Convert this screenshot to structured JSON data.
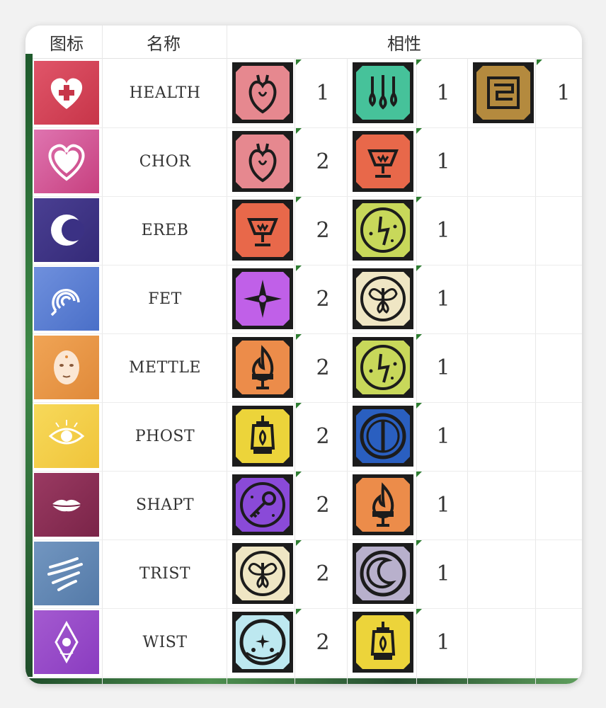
{
  "headers": {
    "icon": "图标",
    "name": "名称",
    "affinity": "相性"
  },
  "rows": [
    {
      "name": "HEALTH",
      "icon": "heart-plus-icon",
      "color_top": "#e05569",
      "color_bottom": "#c73549",
      "affinities": [
        {
          "icon": "anatomical-heart-icon",
          "bg": "#e6888f",
          "value": "1"
        },
        {
          "icon": "drops-icon",
          "bg": "#46c29a",
          "value": "1"
        },
        {
          "icon": "rune-tablet-icon",
          "bg": "#b48a3e",
          "value": "1"
        }
      ]
    },
    {
      "name": "CHOR",
      "icon": "heart-icon",
      "color_top": "#df74b0",
      "color_bottom": "#c7407f",
      "affinities": [
        {
          "icon": "anatomical-heart-icon",
          "bg": "#e6888f",
          "value": "2"
        },
        {
          "icon": "chalice-icon",
          "bg": "#e8684a",
          "value": "1"
        }
      ]
    },
    {
      "name": "EREB",
      "icon": "crescent-moon-icon",
      "color_top": "#4a3f92",
      "color_bottom": "#342a78",
      "affinities": [
        {
          "icon": "chalice-icon",
          "bg": "#e8684a",
          "value": "2"
        },
        {
          "icon": "lightning-icon",
          "bg": "#c8d85a",
          "value": "1"
        }
      ]
    },
    {
      "name": "FET",
      "icon": "spiral-icon",
      "color_top": "#6f90dd",
      "color_bottom": "#4a6fc8",
      "affinities": [
        {
          "icon": "star-compass-icon",
          "bg": "#c060e8",
          "value": "2"
        },
        {
          "icon": "moth-icon",
          "bg": "#efe6c4",
          "value": "1"
        }
      ]
    },
    {
      "name": "METTLE",
      "icon": "mask-icon",
      "color_top": "#f0a455",
      "color_bottom": "#e08a3a",
      "affinities": [
        {
          "icon": "flame-anvil-icon",
          "bg": "#ec8c4a",
          "value": "2"
        },
        {
          "icon": "lightning-icon",
          "bg": "#c8d85a",
          "value": "1"
        }
      ]
    },
    {
      "name": "PHOST",
      "icon": "eye-icon",
      "color_top": "#f7d95a",
      "color_bottom": "#f0c43a",
      "affinities": [
        {
          "icon": "lantern-icon",
          "bg": "#ecd43a",
          "value": "2"
        },
        {
          "icon": "shield-orb-icon",
          "bg": "#2a5fc0",
          "value": "1"
        }
      ]
    },
    {
      "name": "SHAPT",
      "icon": "lips-icon",
      "color_top": "#9a3a62",
      "color_bottom": "#7a2448",
      "affinities": [
        {
          "icon": "key-icon",
          "bg": "#8a4ad8",
          "value": "2"
        },
        {
          "icon": "flame-anvil-icon",
          "bg": "#ec8c4a",
          "value": "1"
        }
      ]
    },
    {
      "name": "TRIST",
      "icon": "wind-icon",
      "color_top": "#7296c0",
      "color_bottom": "#547aa8",
      "affinities": [
        {
          "icon": "moth-icon",
          "bg": "#efe6c4",
          "value": "2"
        },
        {
          "icon": "moon-icon",
          "bg": "#b8b0cc",
          "value": "1"
        }
      ]
    },
    {
      "name": "WIST",
      "icon": "crystal-icon",
      "color_top": "#a45ad0",
      "color_bottom": "#8a3cc0",
      "affinities": [
        {
          "icon": "sparkle-orb-icon",
          "bg": "#bde8f0",
          "value": "2"
        },
        {
          "icon": "lantern-icon",
          "bg": "#ecd43a",
          "value": "1"
        }
      ]
    }
  ]
}
